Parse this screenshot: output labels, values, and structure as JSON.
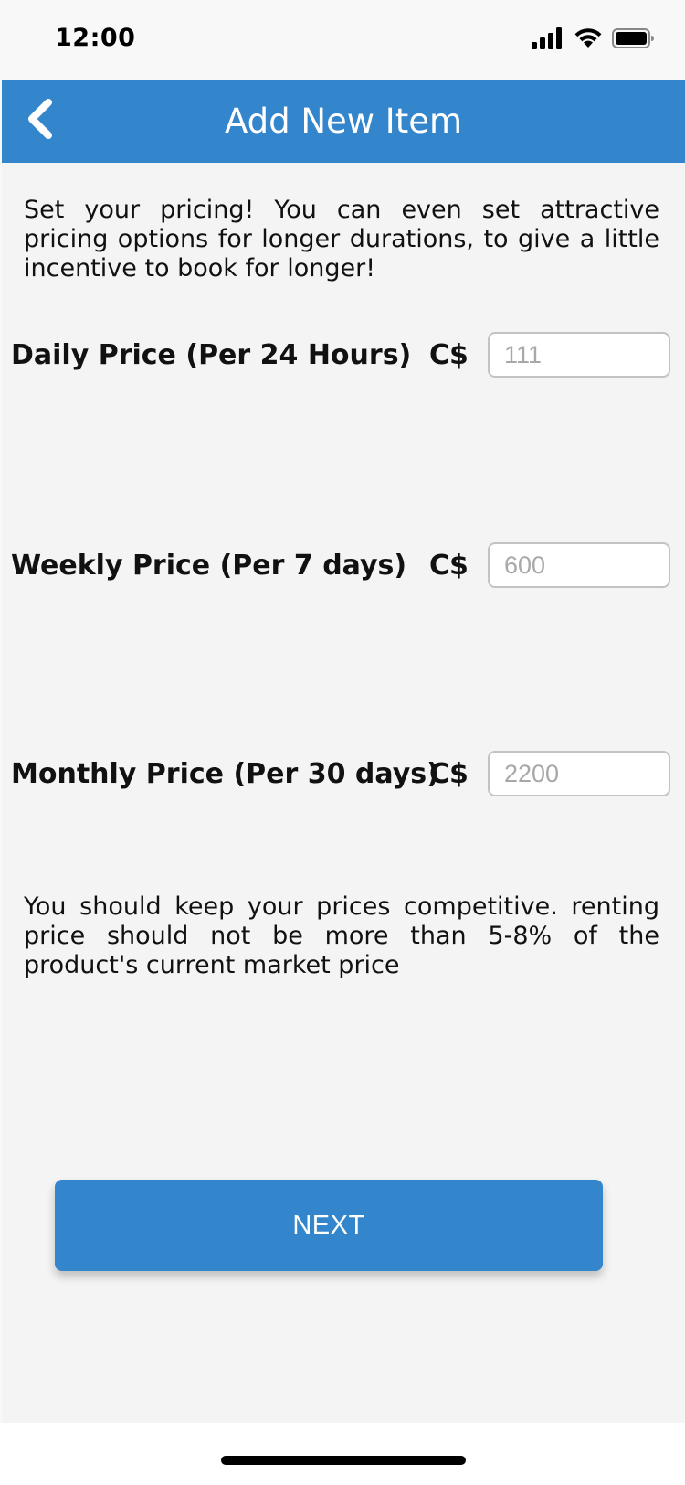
{
  "status_bar": {
    "time": "12:00",
    "icons": [
      "signal-icon",
      "wifi-icon",
      "battery-icon"
    ]
  },
  "header": {
    "title": "Add New Item",
    "back_icon": "chevron-left-icon",
    "background": "#3385cc"
  },
  "intro_text": "Set your pricing! You can even set attractive pricing options for longer durations, to give a little incentive to book for longer!",
  "pricing": {
    "currency": "C$",
    "daily": {
      "label": "Daily Price (Per 24 Hours)",
      "placeholder": "111"
    },
    "weekly": {
      "label": "Weekly Price (Per 7 days)",
      "placeholder": "600"
    },
    "monthly": {
      "label": "Monthly Price (Per 30 days)",
      "placeholder": "2200"
    }
  },
  "advice_text": "You should keep your prices competitive. renting price should not be more than 5-8% of the product's current market price",
  "next_button": {
    "label": "NEXT",
    "background": "#3385cc"
  }
}
